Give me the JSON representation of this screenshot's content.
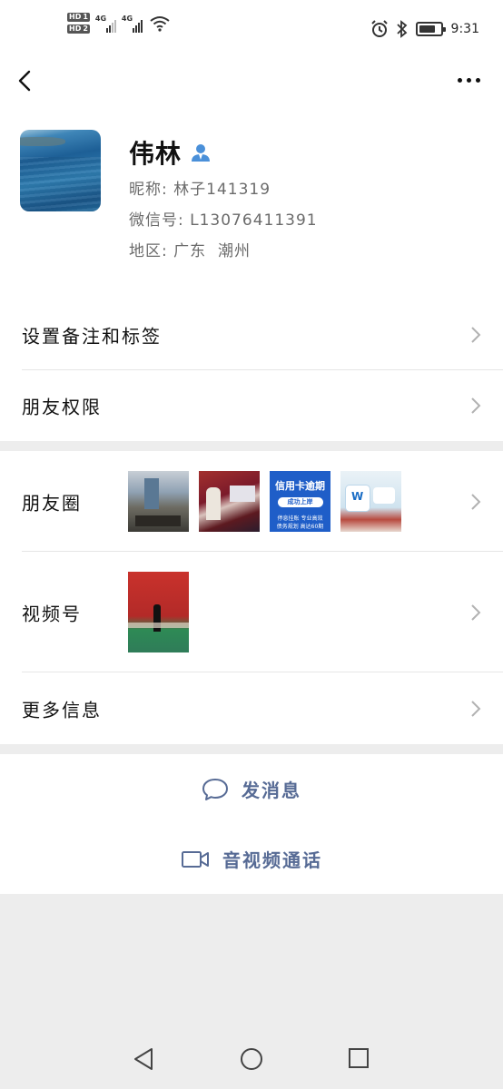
{
  "status_bar": {
    "hd1": "HD",
    "hd1_num": "1",
    "hd2": "HD",
    "hd2_num": "2",
    "net1": "4G",
    "net2": "4G",
    "battery_level": 0.8,
    "time": "9:31",
    "icons": [
      "alarm-icon",
      "bluetooth-icon",
      "wifi-icon",
      "battery-icon"
    ]
  },
  "header": {
    "back_icon": "chevron-left-icon",
    "more_icon": "more-dots-icon"
  },
  "profile": {
    "name": "伟林",
    "nickname_label": "昵称:",
    "nickname": "林子141319",
    "wechat_id_label": "微信号:",
    "wechat_id": "L13076411391",
    "region_label": "地区:",
    "region": "广东  潮州",
    "badge_icon": "person-icon"
  },
  "menu": {
    "remark_tags": "设置备注和标签",
    "friend_permissions": "朋友权限",
    "moments": "朋友圈",
    "channels": "视频号",
    "more_info": "更多信息"
  },
  "moments_thumbs": {
    "t3_line1": "信用卡逾期",
    "t3_line2": "成功上岸",
    "t3_line3": "停息挂账  专业高效",
    "t3_line4": "债务规划  高达60期",
    "t4_mark": "W"
  },
  "actions": {
    "send_message": "发消息",
    "video_call": "音视频通话"
  },
  "colors": {
    "link": "#576b95",
    "background": "#ededed",
    "card": "#ffffff",
    "badge": "#4a90d9"
  }
}
